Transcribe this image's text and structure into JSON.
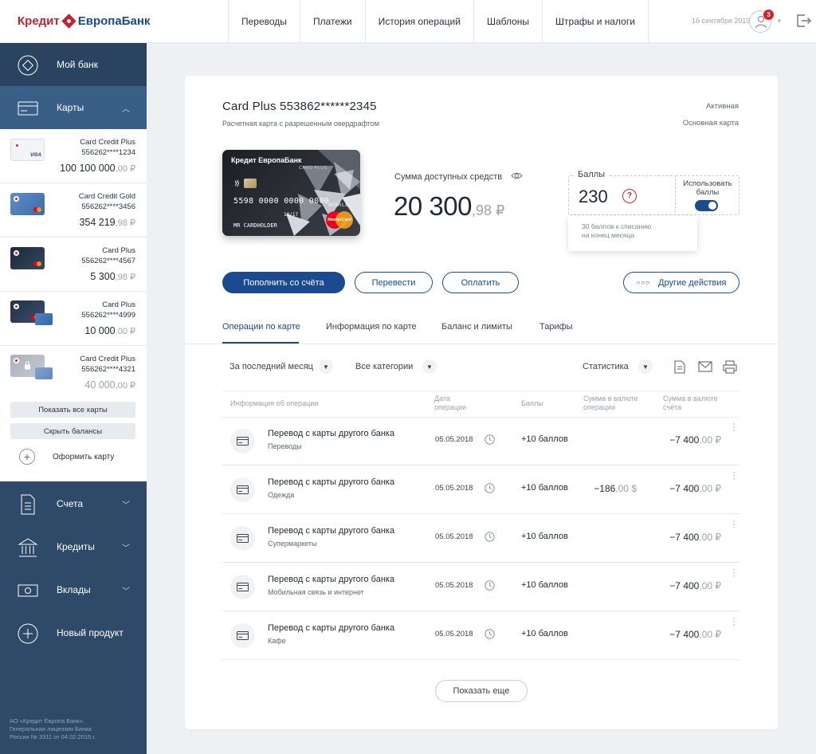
{
  "header": {
    "logo_part1": "Кредит",
    "logo_part2": "ЕвропаБанк",
    "nav": [
      "Переводы",
      "Платежи",
      "История операций",
      "Шаблоны",
      "Штрафы и налоги"
    ],
    "date": "16 сентября 2019",
    "notifications": "3"
  },
  "sidebar": {
    "my_bank": "Мой банк",
    "cards_label": "Карты",
    "cards": [
      {
        "name": "Card Credit Plus",
        "number": "556262****1234",
        "balance": "100 100 000",
        "kop": ",00 ₽",
        "payment": "VISA",
        "muted": false
      },
      {
        "name": "Card Credit Gold",
        "number": "556262****3456",
        "balance": "354 219",
        "kop": ",98 ₽",
        "payment": "mastercard",
        "muted": false
      },
      {
        "name": "Card Plus",
        "number": "556262****4567",
        "balance": "5 300",
        "kop": ",98 ₽",
        "payment": "mastercard",
        "muted": false
      },
      {
        "name": "Card Plus",
        "number": "556262****4999",
        "balance": "10 000",
        "kop": ",00 ₽",
        "payment": "mastercard",
        "muted": false
      },
      {
        "name": "Card Credit Plus",
        "number": "556262****4321",
        "balance": "40 000",
        "kop": ",00 ₽",
        "payment": "mastercard",
        "muted": true
      }
    ],
    "show_all_cards": "Показать все карты",
    "hide_balances": "Скрыть балансы",
    "order_card": "Оформить карту",
    "accounts": "Счета",
    "credits": "Кредиты",
    "deposits": "Вклады",
    "new_product": "Новый продукт",
    "footer": [
      "АО «Кредит Европа Банк».",
      "Генеральная лицензия Банка",
      "России № 3311 от 04.02.2015 г."
    ]
  },
  "card": {
    "title": "Card Plus 553862******2345",
    "subtitle": "Расчетная карта с разрешенным овердрафтом",
    "status": "Активная",
    "role": "Основная карта",
    "image": {
      "bank": "Кредит ЕвропаБанк",
      "product": "CARD PLUS",
      "number": "5598 0000 0000 0000",
      "valid_thru": "10/17",
      "world": "WORLD",
      "holder": "MR CARDHOLDER",
      "brand": "MasterCard"
    },
    "available_label": "Сумма доступных средств",
    "available_amount": "20 300",
    "available_kop": ",98 ₽",
    "points_label": "Баллы",
    "points_value": "230",
    "use_points_label": "Использовать баллы",
    "use_points_enabled": true,
    "points_tooltip_line1": "30 баллов к списанию",
    "points_tooltip_line2": "на конец месяца"
  },
  "actions": {
    "top_up": "Пополнить со счёта",
    "transfer": "Перевести",
    "pay": "Оплатить",
    "other": "Другие действия"
  },
  "tabs": [
    "Операции по карте",
    "Информация по карте",
    "Баланс и лимиты",
    "Тарифы"
  ],
  "filters": {
    "period": "За последний месяц",
    "category": "Все категории",
    "statistics": "Статистика"
  },
  "table": {
    "headers": {
      "info": "Информация об операции",
      "date_1": "Дата",
      "date_2": "операции",
      "points": "Баллы",
      "cur_1": "Сумма в валюте",
      "cur_2": "операции",
      "acc_1": "Сумма в валюте",
      "acc_2": "счёта"
    },
    "rows": [
      {
        "title": "Перевод с карты другого банка",
        "category": "Переводы",
        "date": "05.05.2018",
        "points": "+10 баллов",
        "cur_amount": "",
        "cur_kop": "",
        "amount": "−7 400",
        "kop": ",00 ₽"
      },
      {
        "title": "Перевод с карты другого банка",
        "category": "Одежда",
        "date": "05.05.2018",
        "points": "+10 баллов",
        "cur_amount": "−186",
        "cur_kop": ",00 $",
        "amount": "−7 400",
        "kop": ",00 ₽"
      },
      {
        "title": "Перевод с карты другого банка",
        "category": "Супермаркеты",
        "date": "05.05.2018",
        "points": "+10 баллов",
        "cur_amount": "",
        "cur_kop": "",
        "amount": "−7 400",
        "kop": ",00 ₽"
      },
      {
        "title": "Перевод с карты другого банка",
        "category": "Мобильная связь и интернет",
        "date": "05.05.2018",
        "points": "+10 баллов",
        "cur_amount": "",
        "cur_kop": "",
        "amount": "−7 400",
        "kop": ",00 ₽"
      },
      {
        "title": "Перевод с карты другого банка",
        "category": "Кафе",
        "date": "05.05.2018",
        "points": "+10 баллов",
        "cur_amount": "",
        "cur_kop": "",
        "amount": "−7 400",
        "kop": ",00 ₽"
      }
    ],
    "show_more": "Показать еще"
  },
  "colors": {
    "brand_red": "#c8202f",
    "brand_blue": "#1a4a8f",
    "sidebar": "#2f4a68"
  }
}
